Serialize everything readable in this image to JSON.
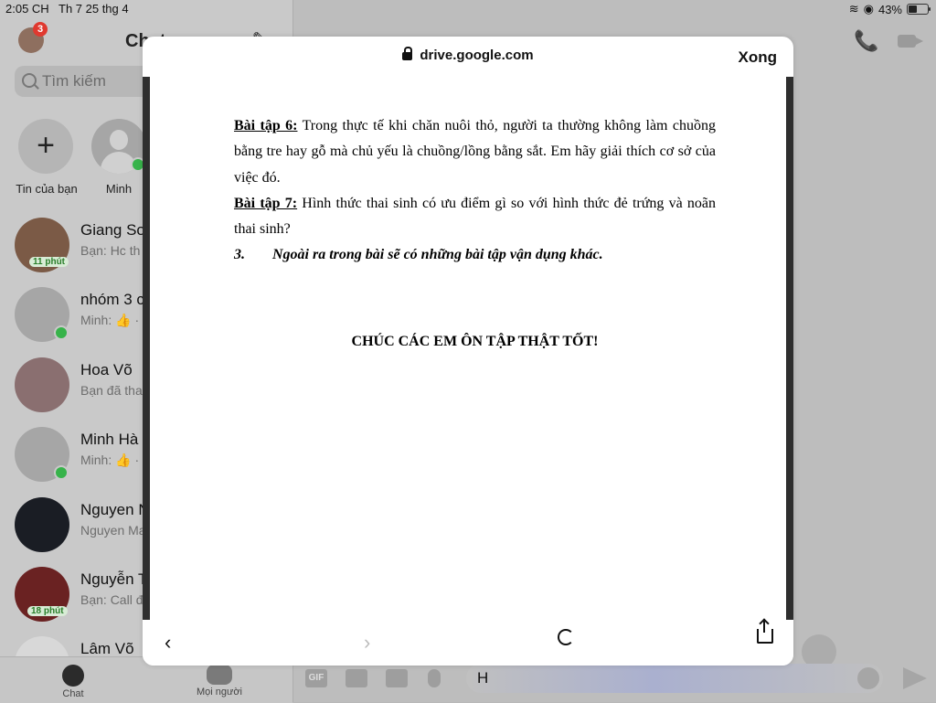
{
  "status_bar": {
    "time": "2:05 CH",
    "date": "Th 7 25 thg 4",
    "battery": "43%",
    "battery_level": 0.43
  },
  "sidebar": {
    "title": "Chat",
    "notification_count": "3",
    "search_placeholder": "Tìm kiếm",
    "stories": [
      {
        "label": "Tin của bạn"
      },
      {
        "label": "Minh"
      }
    ],
    "conversations": [
      {
        "name": "Giang So",
        "preview": "Bạn: Hc th",
        "time_badge": "11 phút"
      },
      {
        "name": "nhóm 3 c",
        "preview": "Minh: 👍 ·"
      },
      {
        "name": "Hoa Võ",
        "preview": "Bạn đã tha"
      },
      {
        "name": "Minh Hà",
        "preview": "Minh: 👍 ·"
      },
      {
        "name": "Nguyen N",
        "preview": "Nguyen Ma"
      },
      {
        "name": "Nguyễn T",
        "preview": "Bạn: Call đ",
        "time_badge": "18 phút"
      },
      {
        "name": "Lâm Võ",
        "preview": ""
      }
    ],
    "bottom_nav": [
      {
        "label": "Chat"
      },
      {
        "label": "Mọi người"
      }
    ]
  },
  "chat": {
    "composer_text": "H",
    "gif_label": "GIF"
  },
  "viewer": {
    "url": "drive.google.com",
    "done_label": "Xong",
    "doc": {
      "ex6_label": "Bài tập 6:",
      "ex6_text": " Trong thực tế khi chăn nuôi thỏ, người ta thường không làm chuồng bằng tre hay gỗ mà chủ yếu là chuồng/lồng bằng sắt. Em hãy giải thích cơ sở của việc đó.",
      "ex7_label": "Bài tập 7:",
      "ex7_text": " Hình thức thai sinh có ưu điểm gì so với hình thức đẻ trứng và noãn thai sinh?",
      "item3_num": "3.",
      "item3_text": "Ngoài ra trong bài sẽ có những bài tập vận dụng khác.",
      "closing": "CHÚC CÁC EM ÔN TẬP THẬT TỐT!"
    }
  },
  "colors": {
    "call_icon": "#c08a00",
    "online": "#37b34a",
    "badge": "#e0392f"
  }
}
